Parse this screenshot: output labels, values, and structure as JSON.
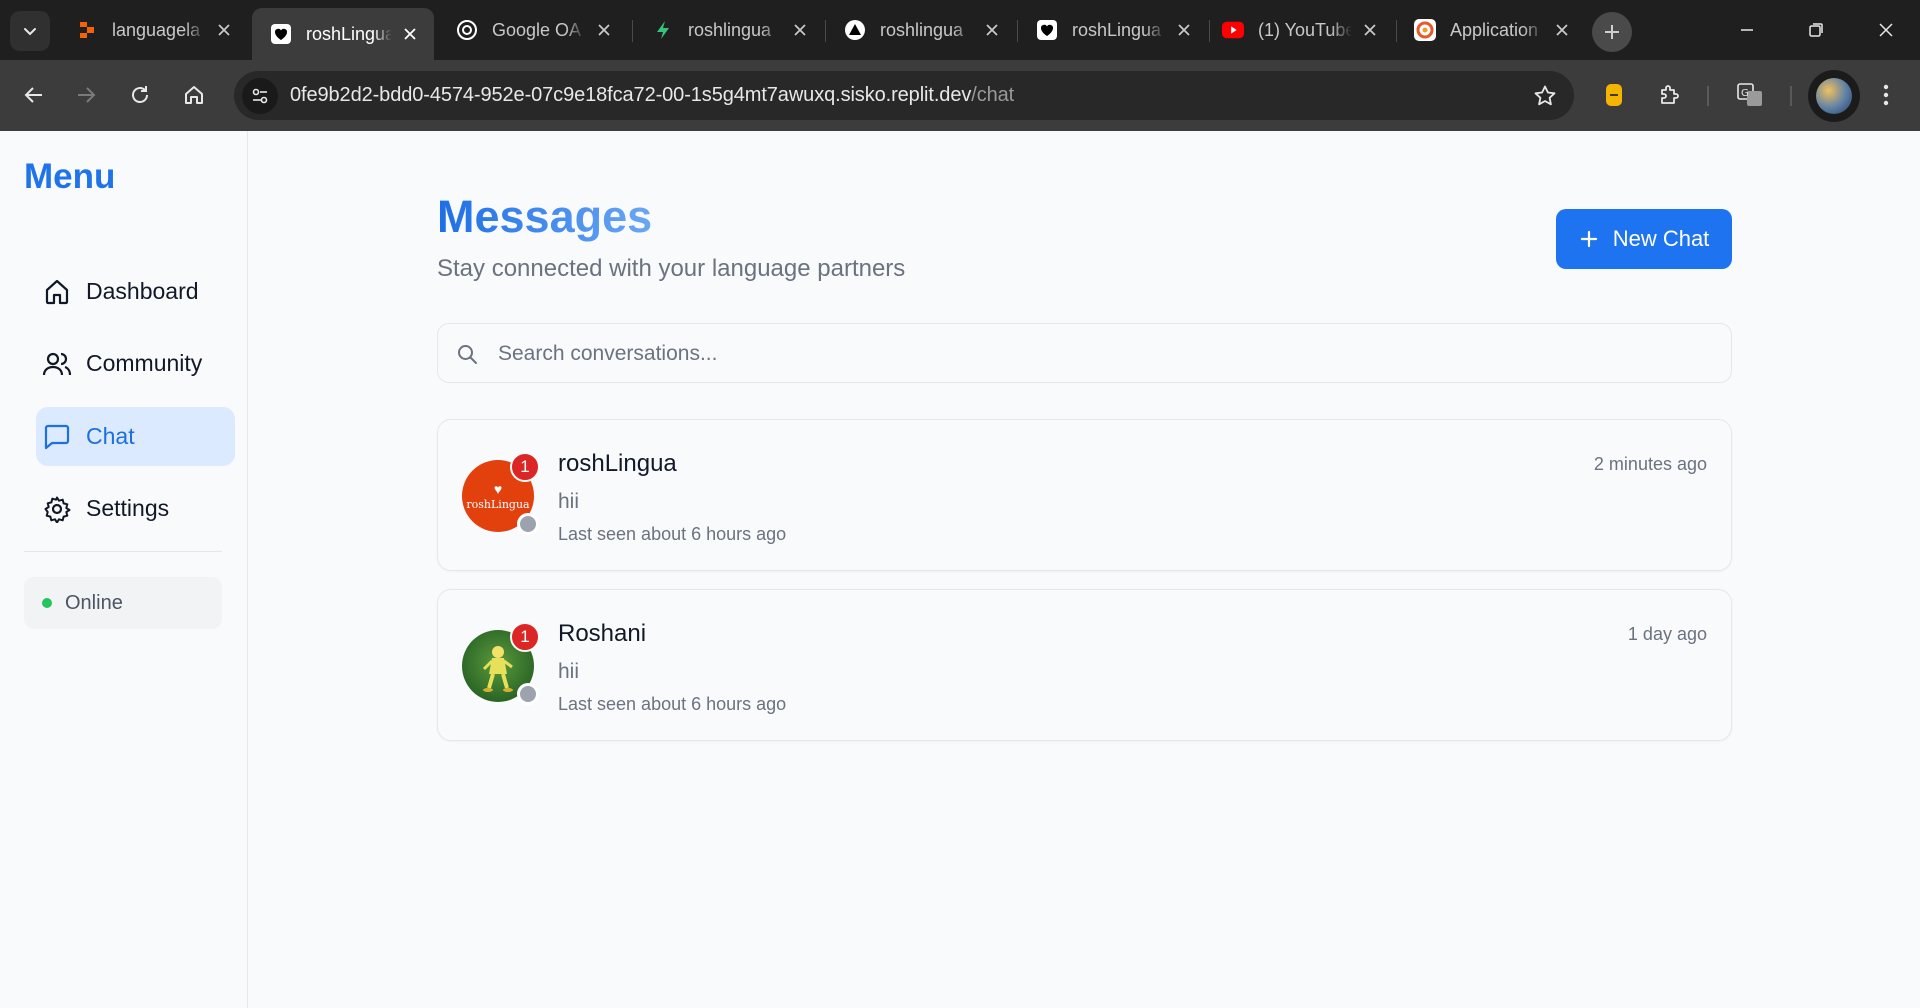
{
  "browser": {
    "tabs": [
      {
        "title": "languagela",
        "favicon": "replit-icon",
        "color": "#f26207"
      },
      {
        "title": "roshLingua",
        "favicon": "heart-icon",
        "color": "#ffffff",
        "active": true
      },
      {
        "title": "Google OA",
        "favicon": "openai-icon",
        "color": "#ffffff"
      },
      {
        "title": "roshlingua",
        "favicon": "bolt-icon",
        "color": "#36c47a"
      },
      {
        "title": "roshlingua",
        "favicon": "triangle-icon",
        "color": "#ffffff"
      },
      {
        "title": "roshLingua",
        "favicon": "heart-icon",
        "color": "#ffffff"
      },
      {
        "title": "(1) YouTube",
        "favicon": "youtube-icon",
        "color": "#ff0000"
      },
      {
        "title": "Application",
        "favicon": "app-icon",
        "color": "#e8572e"
      }
    ],
    "url_host": "0fe9b2d2-bdd0-4574-952e-07c9e18fca72-00-1s5g4mt7awuxq.sisko.replit.dev",
    "url_path": "/chat"
  },
  "sidebar": {
    "title": "Menu",
    "items": [
      {
        "label": "Dashboard",
        "icon": "home-icon"
      },
      {
        "label": "Community",
        "icon": "users-icon"
      },
      {
        "label": "Chat",
        "icon": "message-icon",
        "active": true
      },
      {
        "label": "Settings",
        "icon": "gear-icon"
      }
    ],
    "status": "Online"
  },
  "main": {
    "title": "Messages",
    "subtitle": "Stay connected with your language partners",
    "new_chat_label": "New Chat",
    "search_placeholder": "Search conversations...",
    "conversations": [
      {
        "name": "roshLingua",
        "avatar_text": "roshLingua",
        "message": "hii",
        "last_seen": "Last seen about 6 hours ago",
        "time": "2 minutes ago",
        "unread": "1"
      },
      {
        "name": "Roshani",
        "message": "hii",
        "last_seen": "Last seen about 6 hours ago",
        "time": "1 day ago",
        "unread": "1"
      }
    ]
  },
  "colors": {
    "accent": "#1e74e8",
    "active_nav_bg": "#dbeafe",
    "online": "#22c55e",
    "unread": "#dc2626"
  }
}
